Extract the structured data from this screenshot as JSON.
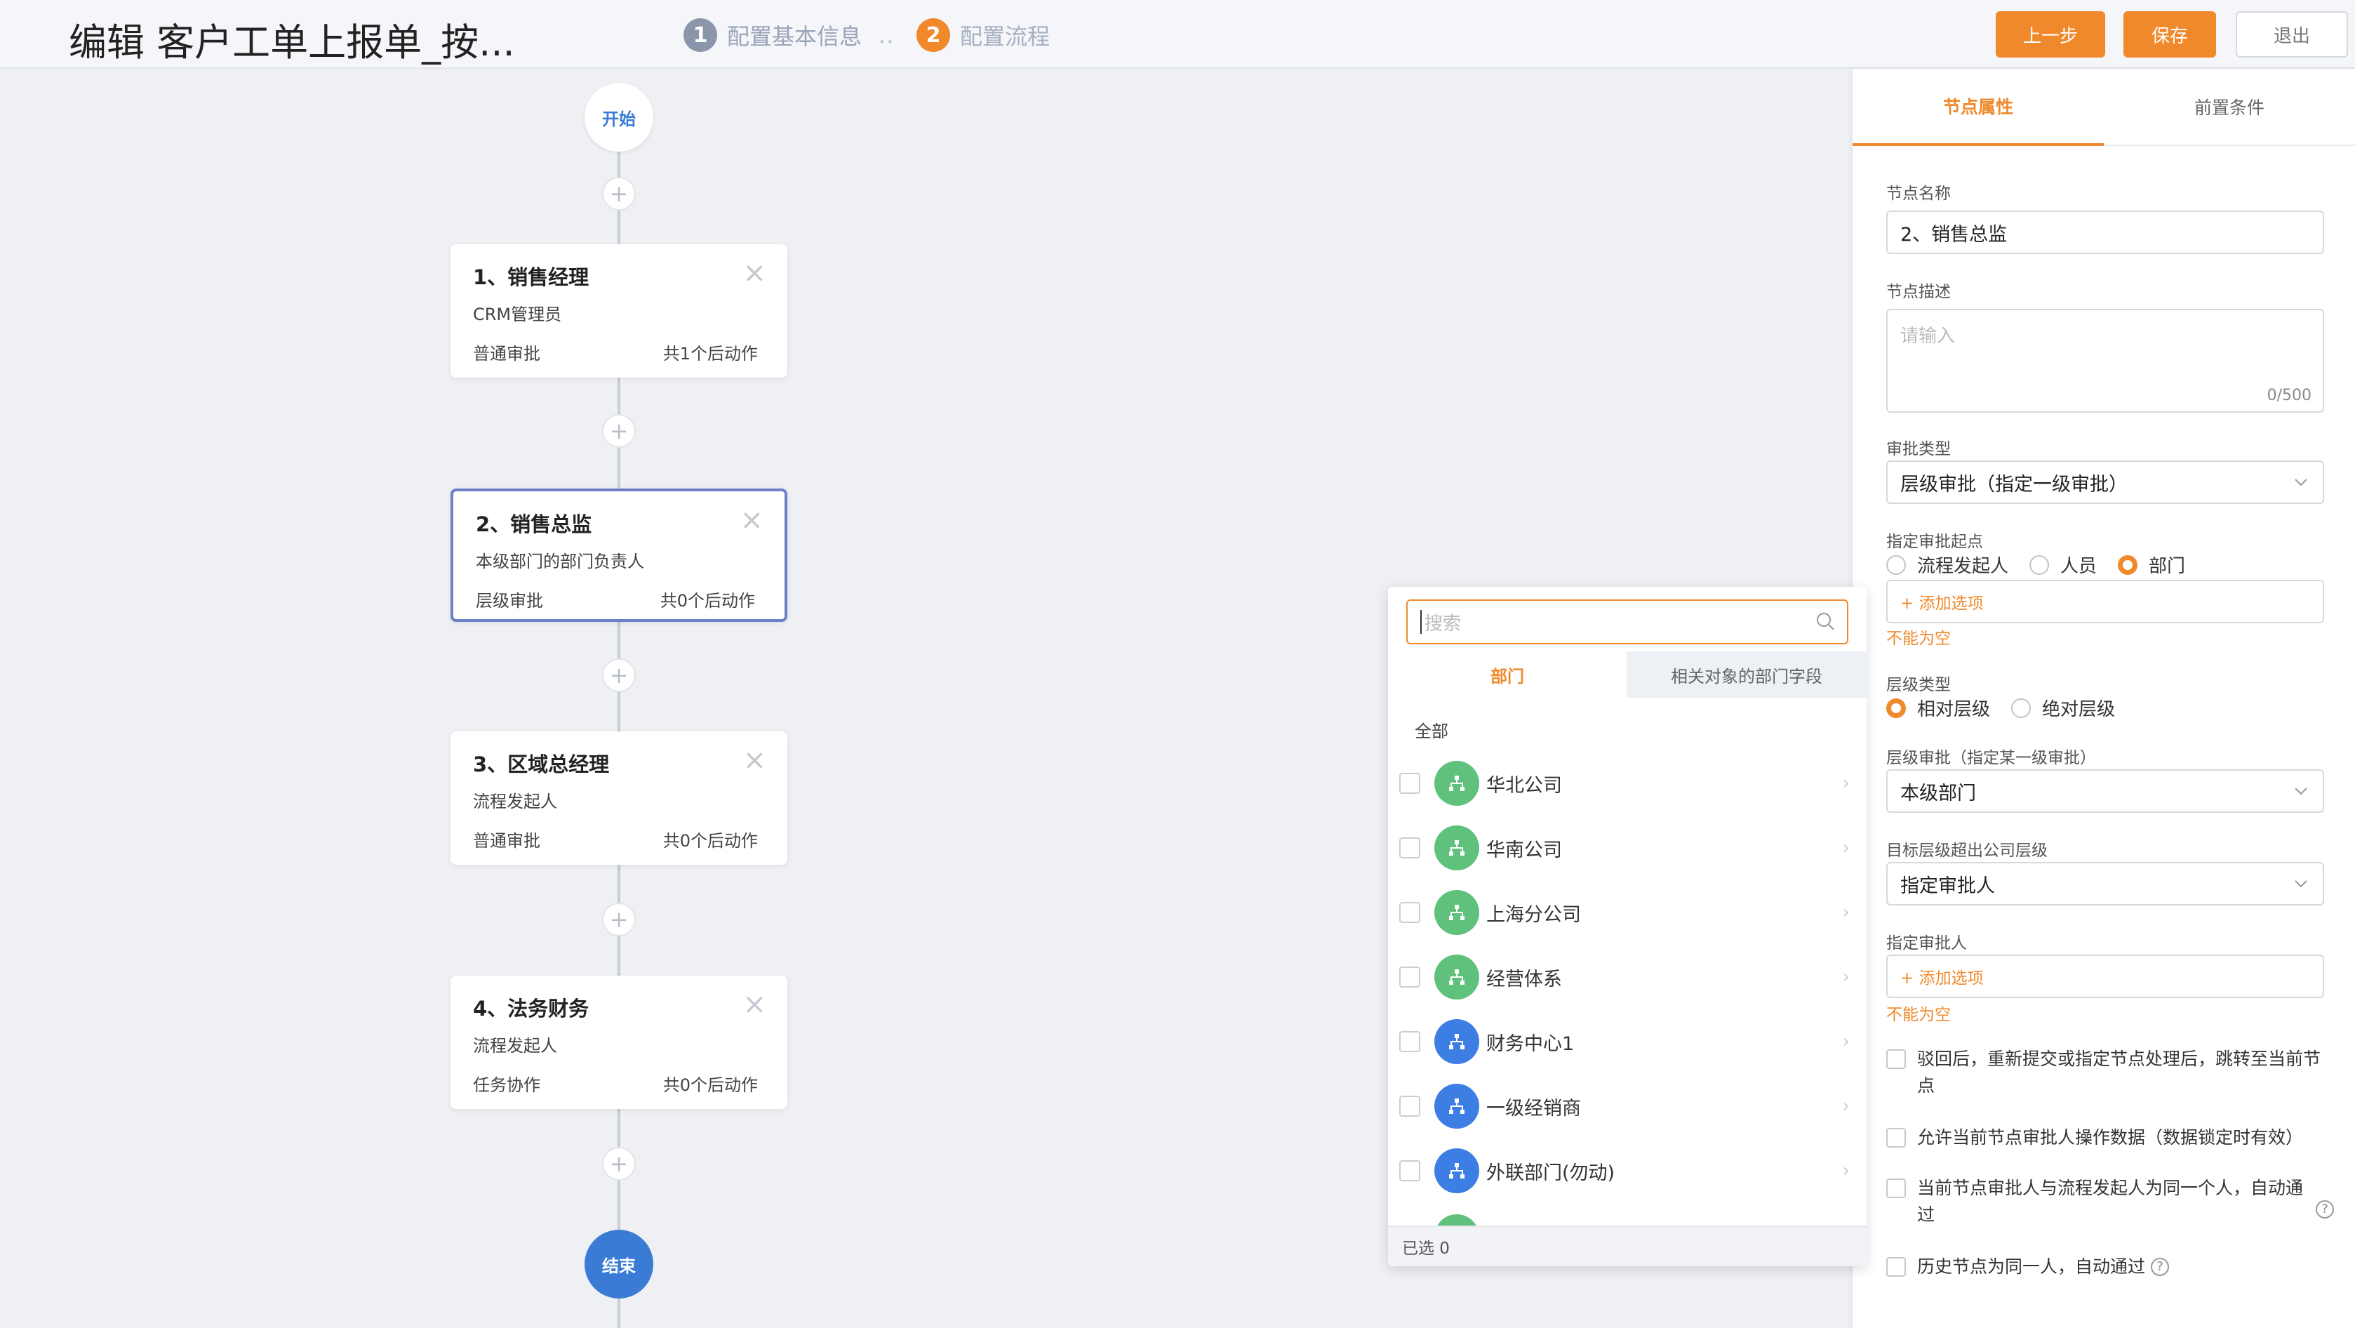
{
  "header": {
    "title": "编辑 客户工单上报单_按...",
    "steps": [
      {
        "num": "1",
        "label": "配置基本信息"
      },
      {
        "num": "2",
        "label": "配置流程"
      }
    ],
    "step_sep": "..",
    "prev_label": "上一步",
    "save_label": "保存",
    "exit_label": "退出"
  },
  "flow": {
    "start_label": "开始",
    "end_label": "结束",
    "plus": "+",
    "nodes": [
      {
        "name": "1、销售经理",
        "sub": "CRM管理员",
        "type": "普通审批",
        "actions": "共1个后动作"
      },
      {
        "name": "2、销售总监",
        "sub": "本级部门的部门负责人",
        "type": "层级审批",
        "actions": "共0个后动作"
      },
      {
        "name": "3、区域总经理",
        "sub": "流程发起人",
        "type": "普通审批",
        "actions": "共0个后动作"
      },
      {
        "name": "4、法务财务",
        "sub": "流程发起人",
        "type": "任务协作",
        "actions": "共0个后动作"
      }
    ]
  },
  "popover": {
    "search_placeholder": "搜索",
    "tabs": [
      "部门",
      "相关对象的部门字段"
    ],
    "all_label": "全部",
    "departments": [
      {
        "name": "华北公司",
        "color": "green"
      },
      {
        "name": "华南公司",
        "color": "green"
      },
      {
        "name": "上海分公司",
        "color": "green"
      },
      {
        "name": "经营体系",
        "color": "green"
      },
      {
        "name": "财务中心1",
        "color": "blue"
      },
      {
        "name": "一级经销商",
        "color": "blue"
      },
      {
        "name": "外联部门(勿动)",
        "color": "blue"
      }
    ],
    "selected_count": "已选 0"
  },
  "panel": {
    "tabs": [
      "节点属性",
      "前置条件"
    ],
    "node_name_label": "节点名称",
    "node_name_value": "2、销售总监",
    "node_desc_label": "节点描述",
    "node_desc_placeholder": "请输入",
    "node_desc_count": "0/500",
    "approval_type_label": "审批类型",
    "approval_type_value": "层级审批（指定一级审批）",
    "start_point_label": "指定审批起点",
    "start_point_options": [
      "流程发起人",
      "人员",
      "部门"
    ],
    "add_option": "+ 添加选项",
    "not_empty": "不能为空",
    "level_type_label": "层级类型",
    "level_type_options": [
      "相对层级",
      "绝对层级"
    ],
    "level_approval_label": "层级审批（指定某一级审批）",
    "level_approval_value": "本级部门",
    "exceed_label": "目标层级超出公司层级",
    "exceed_value": "指定审批人",
    "approver_label": "指定审批人",
    "checks": [
      "驳回后，重新提交或指定节点处理后，跳转至当前节点",
      "允许当前节点审批人操作数据（数据锁定时有效）",
      "当前节点审批人与流程发起人为同一个人，自动通过",
      "历史节点为同一人，自动通过"
    ]
  },
  "colors": {
    "accent": "#f0892b",
    "blue": "#3a7bd5",
    "selected_border": "#6b80c7"
  }
}
